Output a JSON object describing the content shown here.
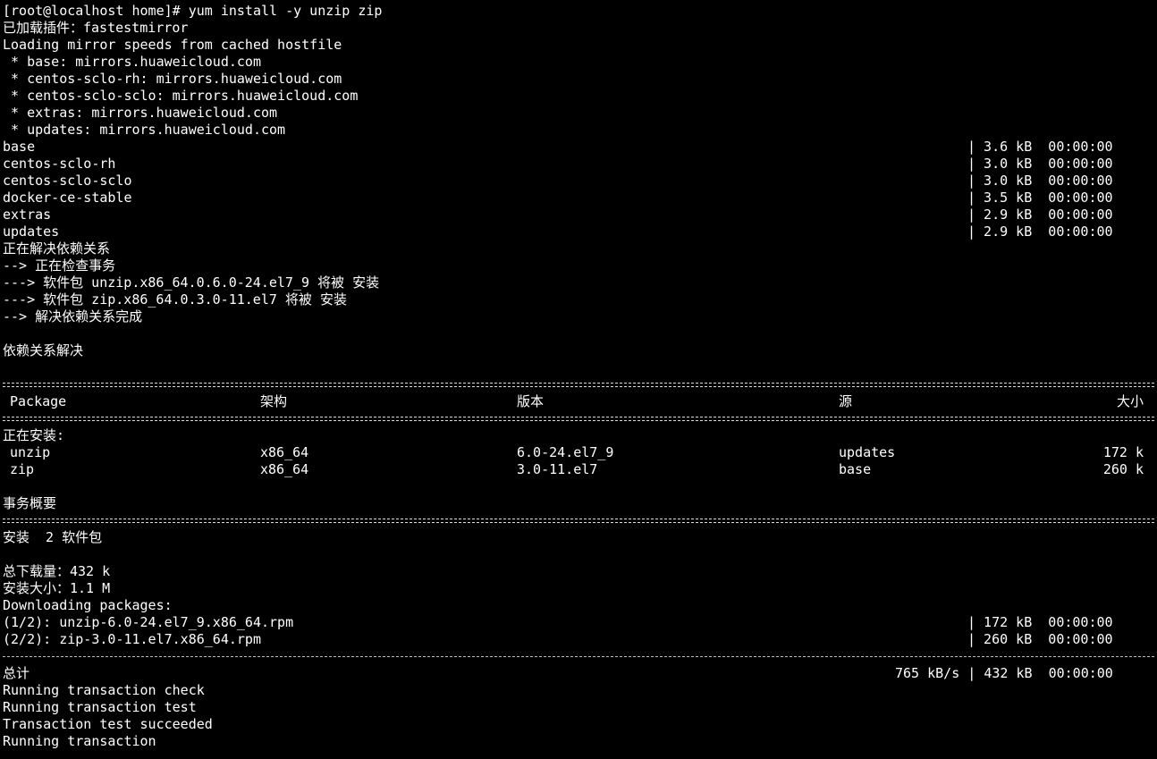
{
  "terminal": {
    "prompt_line": "[root@localhost home]# yum install -y unzip zip",
    "plugins_line": "已加载插件：fastestmirror",
    "loading_line": "Loading mirror speeds from cached hostfile",
    "mirrors": [
      " * base: mirrors.huaweicloud.com",
      " * centos-sclo-rh: mirrors.huaweicloud.com",
      " * centos-sclo-sclo: mirrors.huaweicloud.com",
      " * extras: mirrors.huaweicloud.com",
      " * updates: mirrors.huaweicloud.com"
    ],
    "repos": [
      {
        "name": "base",
        "stat": "| 3.6 kB  00:00:00"
      },
      {
        "name": "centos-sclo-rh",
        "stat": "| 3.0 kB  00:00:00"
      },
      {
        "name": "centos-sclo-sclo",
        "stat": "| 3.0 kB  00:00:00"
      },
      {
        "name": "docker-ce-stable",
        "stat": "| 3.5 kB  00:00:00"
      },
      {
        "name": "extras",
        "stat": "| 2.9 kB  00:00:00"
      },
      {
        "name": "updates",
        "stat": "| 2.9 kB  00:00:00"
      }
    ],
    "resolve_lines": [
      "正在解决依赖关系",
      "--> 正在检查事务",
      "---> 软件包 unzip.x86_64.0.6.0-24.el7_9 将被 安装",
      "---> 软件包 zip.x86_64.0.3.0-11.el7 将被 安装",
      "--> 解决依赖关系完成"
    ],
    "resolved_line": "依赖关系解决",
    "table": {
      "headers": [
        "Package",
        "架构",
        "版本",
        "源",
        "大小"
      ],
      "installing_label": "正在安装:",
      "rows": [
        [
          "unzip",
          "x86_64",
          "6.0-24.el7_9",
          "updates",
          "172 k"
        ],
        [
          "zip",
          "x86_64",
          "3.0-11.el7",
          "base",
          "260 k"
        ]
      ]
    },
    "summary_title": "事务概要",
    "install_count": "安装  2 软件包",
    "total_download": "总下载量：432 k",
    "install_size": "安装大小：1.1 M",
    "downloading_label": "Downloading packages:",
    "downloads": [
      {
        "name": "(1/2): unzip-6.0-24.el7_9.x86_64.rpm",
        "stat": "| 172 kB  00:00:00"
      },
      {
        "name": "(2/2): zip-3.0-11.el7.x86_64.rpm",
        "stat": "| 260 kB  00:00:00"
      }
    ],
    "total_label": "总计",
    "total_stat": "765 kB/s | 432 kB  00:00:00",
    "transaction_lines": [
      "Running transaction check",
      "Running transaction test",
      "Transaction test succeeded",
      "Running transaction"
    ]
  }
}
